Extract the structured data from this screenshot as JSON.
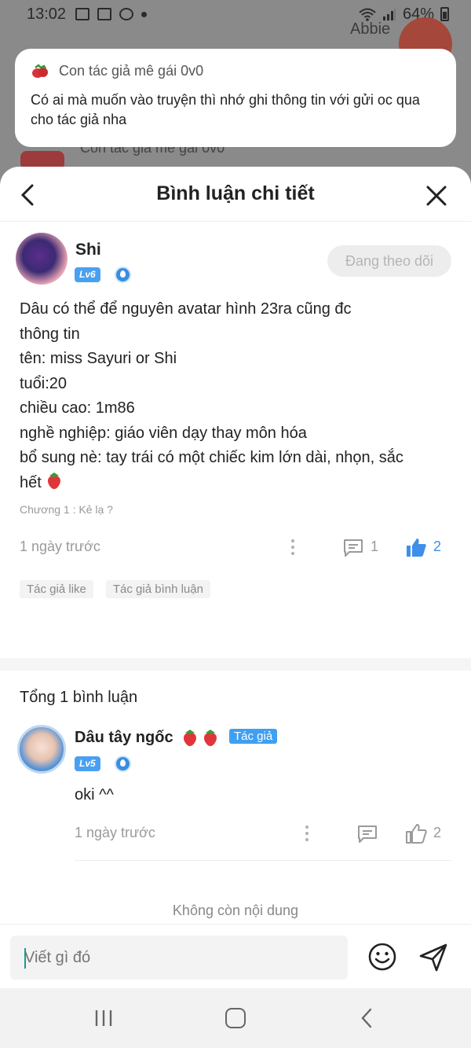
{
  "status_bar": {
    "time": "13:02",
    "battery": "64%"
  },
  "background": {
    "user_name": "Abbie",
    "author_label": "Con tác giả mê gái 0v0"
  },
  "notification": {
    "title": "Con tác giả mê gái 0v0",
    "body": "Có ai mà muốn vào truyện thì nhớ ghi thông tin với gửi oc qua cho tác giả nha",
    "icon": "strawberry-icon"
  },
  "sheet": {
    "title": "Bình luận chi tiết"
  },
  "post": {
    "username": "Shi",
    "level": "Lv6",
    "follow_label": "Đang theo dõi",
    "lines": [
      "Dâu có thể để nguyên avatar hình 23ra cũng đc",
      "thông tin",
      "tên: miss Sayuri or Shi",
      "tuổi:20",
      "chiều cao: 1m86",
      "nghề nghiệp: giáo viên dạy thay môn hóa",
      "bổ sung nè: tay trái có một chiếc kim lớn dài, nhọn, sắc",
      "hết"
    ],
    "chapter": "Chương 1 : Kẻ lạ ?",
    "time": "1 ngày trước",
    "comment_count": "1",
    "like_count": "2",
    "tags": [
      "Tác giả like",
      "Tác giả bình luận"
    ]
  },
  "comments": {
    "total_label": "Tổng 1 bình luận",
    "items": [
      {
        "name": "Dâu tây ngốc",
        "level": "Lv5",
        "badge": "Tác giả",
        "text": "oki ^^",
        "time": "1 ngày trước",
        "like_count": "2"
      }
    ],
    "end_label": "Không còn nội dung"
  },
  "input": {
    "placeholder": "Viết gì đó"
  },
  "colors": {
    "accent": "#3f9ff0",
    "like_active": "#3f8ee8",
    "muted": "#9a9a9a"
  }
}
